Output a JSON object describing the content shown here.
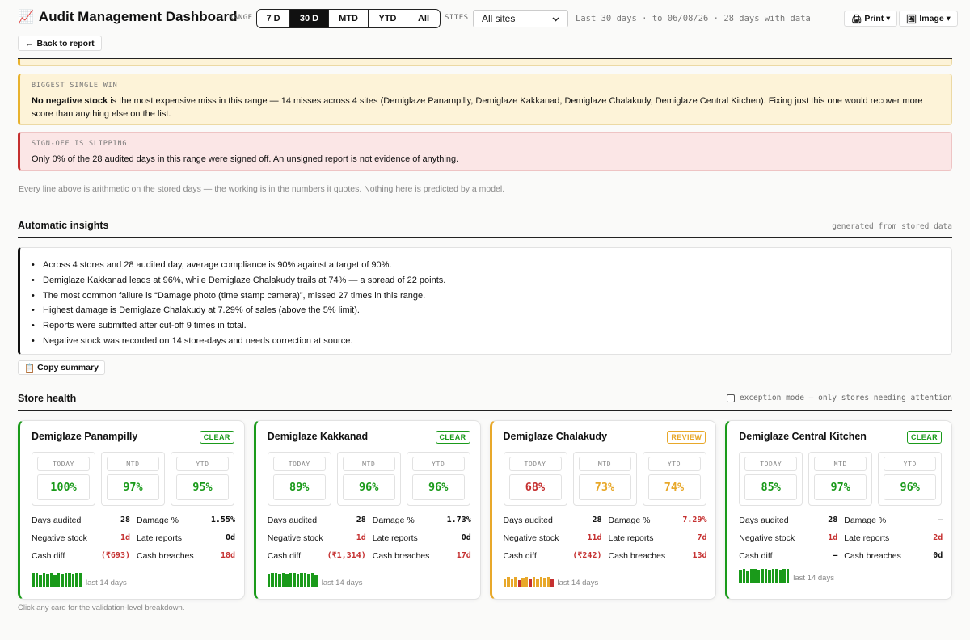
{
  "header": {
    "title": "Audit Management Dashboard",
    "title_icon": "📈",
    "range_label": "RANGE",
    "range_options": [
      "7 D",
      "30 D",
      "MTD",
      "YTD",
      "All"
    ],
    "range_selected": "30 D",
    "sites_label": "SITES",
    "sites_value": "All sites",
    "range_info": "Last 30 days · to 06/08/26 · 28 days with data",
    "print_label": "Print ▾",
    "image_label": "Image ▾",
    "back_label": "Back to report"
  },
  "alerts": {
    "win": {
      "kicker": "BIGGEST SINGLE WIN",
      "bold": "No negative stock",
      "text": " is the most expensive miss in this range — 14 misses across 4 sites (Demiglaze Panampilly, Demiglaze Kakkanad, Demiglaze Chalakudy, Demiglaze Central Kitchen). Fixing just this one would recover more score than anything else on the list."
    },
    "slip": {
      "kicker": "SIGN-OFF IS SLIPPING",
      "text": "Only 0% of the 28 audited days in this range were signed off. An unsigned report is not evidence of anything."
    },
    "footnote": "Every line above is arithmetic on the stored days — the working is in the numbers it quotes. Nothing here is predicted by a model."
  },
  "insights": {
    "title": "Automatic insights",
    "aside": "generated from stored data",
    "items": [
      "Across 4 stores and 28 audited day, average compliance is 90% against a target of 90%.",
      "Demiglaze Kakkanad leads at 96%, while Demiglaze Chalakudy trails at 74% — a spread of 22 points.",
      "The most common failure is “Damage photo (time stamp camera)”, missed 27 times in this range.",
      "Highest damage is Demiglaze Chalakudy at 7.29% of sales (above the 5% limit).",
      "Reports were submitted after cut-off 9 times in total.",
      "Negative stock was recorded on 14 store-days and needs correction at source."
    ],
    "copy_label": "Copy summary"
  },
  "store_health": {
    "title": "Store health",
    "exception_label": "exception mode — only stores needing attention",
    "period_labels": [
      "TODAY",
      "MTD",
      "YTD"
    ],
    "stat_labels": {
      "days": "Days audited",
      "damage": "Damage %",
      "neg": "Negative stock",
      "late": "Late reports",
      "cash": "Cash diff",
      "breach": "Cash breaches"
    },
    "spark_label": "last 14 days",
    "note": "Click any card for the validation-level breakdown.",
    "stores": [
      {
        "name": "Demiglaze Panampilly",
        "status": "CLEAR",
        "today": "100%",
        "mtd": "97%",
        "ytd": "95%",
        "days": "28",
        "damage": "1.55%",
        "neg": "1d",
        "late": "0d",
        "cash": "(₹693)",
        "breach": "18d"
      },
      {
        "name": "Demiglaze Kakkanad",
        "status": "CLEAR",
        "today": "89%",
        "mtd": "96%",
        "ytd": "96%",
        "days": "28",
        "damage": "1.73%",
        "neg": "1d",
        "late": "0d",
        "cash": "(₹1,314)",
        "breach": "17d"
      },
      {
        "name": "Demiglaze Chalakudy",
        "status": "REVIEW",
        "today": "68%",
        "mtd": "73%",
        "ytd": "74%",
        "days": "28",
        "damage": "7.29%",
        "neg": "11d",
        "late": "7d",
        "cash": "(₹242)",
        "breach": "13d"
      },
      {
        "name": "Demiglaze Central Kitchen",
        "status": "CLEAR",
        "today": "85%",
        "mtd": "97%",
        "ytd": "96%",
        "days": "28",
        "damage": "–",
        "neg": "1d",
        "late": "2d",
        "cash": "–",
        "breach": "0d"
      }
    ]
  },
  "colors": {
    "good": "#1a9a1a",
    "warn": "#e8a82a",
    "bad": "#c53030"
  }
}
